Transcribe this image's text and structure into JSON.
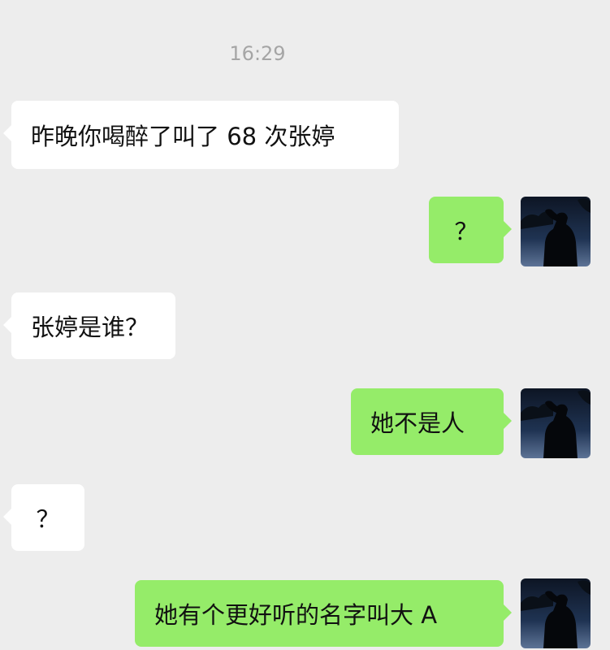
{
  "chat": {
    "timestamp": "16:29",
    "messages": [
      {
        "side": "in",
        "text": "昨晚你喝醉了叫了 68 次张婷"
      },
      {
        "side": "out",
        "text": "？",
        "avatar": "silhouette-avatar"
      },
      {
        "side": "in",
        "text": "张婷是谁？"
      },
      {
        "side": "out",
        "text": "她不是人",
        "avatar": "silhouette-avatar"
      },
      {
        "side": "in",
        "text": "？"
      },
      {
        "side": "out",
        "text": "她有个更好听的名字叫大 A",
        "avatar": "silhouette-avatar"
      }
    ]
  },
  "colors": {
    "background": "#ededed",
    "incoming_bubble": "#ffffff",
    "outgoing_bubble": "#95ec69",
    "timestamp_text": "#a5a5a5"
  }
}
